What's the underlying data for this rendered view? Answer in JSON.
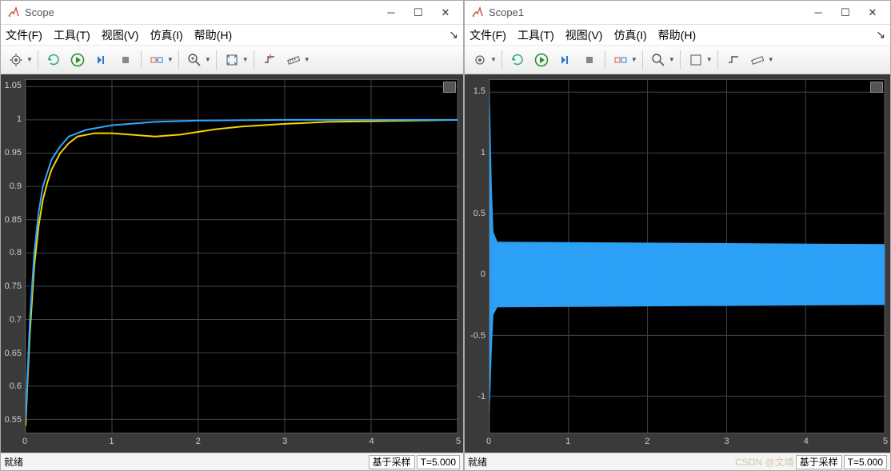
{
  "windows": [
    {
      "title": "Scope",
      "status": "就绪",
      "sampling": "基于采样",
      "time": "T=5.000"
    },
    {
      "title": "Scope1",
      "status": "就绪",
      "sampling": "基于采样",
      "time": "T=5.000"
    }
  ],
  "menubar": [
    "文件(F)",
    "工具(T)",
    "视图(V)",
    "仿真(I)",
    "帮助(H)"
  ],
  "watermark": "CSDN @文靖",
  "chart_data": [
    {
      "type": "line",
      "title": "",
      "xlabel": "",
      "ylabel": "",
      "xlim": [
        0,
        5
      ],
      "ylim": [
        0.53,
        1.06
      ],
      "xticks": [
        0,
        1,
        2,
        3,
        4,
        5
      ],
      "yticks": [
        0.55,
        0.6,
        0.65,
        0.7,
        0.75,
        0.8,
        0.85,
        0.9,
        0.95,
        1,
        1.05
      ],
      "series": [
        {
          "name": "signal-yellow",
          "color": "#f5d400",
          "x": [
            0,
            0.02,
            0.05,
            0.08,
            0.1,
            0.15,
            0.2,
            0.25,
            0.3,
            0.4,
            0.5,
            0.6,
            0.8,
            1.0,
            1.2,
            1.5,
            1.8,
            2.0,
            2.2,
            2.5,
            3.0,
            3.5,
            4.0,
            4.5,
            5.0
          ],
          "y": [
            0.54,
            0.6,
            0.68,
            0.74,
            0.78,
            0.84,
            0.88,
            0.905,
            0.925,
            0.95,
            0.965,
            0.975,
            0.98,
            0.98,
            0.978,
            0.975,
            0.978,
            0.982,
            0.986,
            0.99,
            0.994,
            0.997,
            0.998,
            0.999,
            1.0
          ]
        },
        {
          "name": "signal-blue",
          "color": "#2ea6ff",
          "x": [
            0,
            0.05,
            0.1,
            0.15,
            0.2,
            0.3,
            0.4,
            0.5,
            0.7,
            1.0,
            1.5,
            2.0,
            3.0,
            4.0,
            5.0
          ],
          "y": [
            0.55,
            0.7,
            0.8,
            0.86,
            0.9,
            0.94,
            0.96,
            0.975,
            0.985,
            0.992,
            0.997,
            0.999,
            1.0,
            1.0,
            1.0
          ]
        }
      ]
    },
    {
      "type": "line",
      "title": "",
      "xlabel": "",
      "ylabel": "",
      "xlim": [
        0,
        5
      ],
      "ylim": [
        -1.3,
        1.6
      ],
      "xticks": [
        0,
        1,
        2,
        3,
        4,
        5
      ],
      "yticks": [
        -1,
        -0.5,
        0,
        0.5,
        1,
        1.5
      ],
      "series": [
        {
          "name": "signal",
          "color": "#2ea6ff",
          "note": "high-frequency chatter: initial transient ~±1.3 at t≈0 decaying to quasi-steady chattering band of ≈±0.25 for t>0.05",
          "envelope_x": [
            0,
            0.01,
            0.03,
            0.05,
            0.1,
            5.0
          ],
          "envelope_hi": [
            1.55,
            1.3,
            0.7,
            0.35,
            0.27,
            0.25
          ],
          "envelope_lo": [
            -1.15,
            -1.0,
            -0.6,
            -0.33,
            -0.27,
            -0.25
          ]
        }
      ]
    }
  ]
}
